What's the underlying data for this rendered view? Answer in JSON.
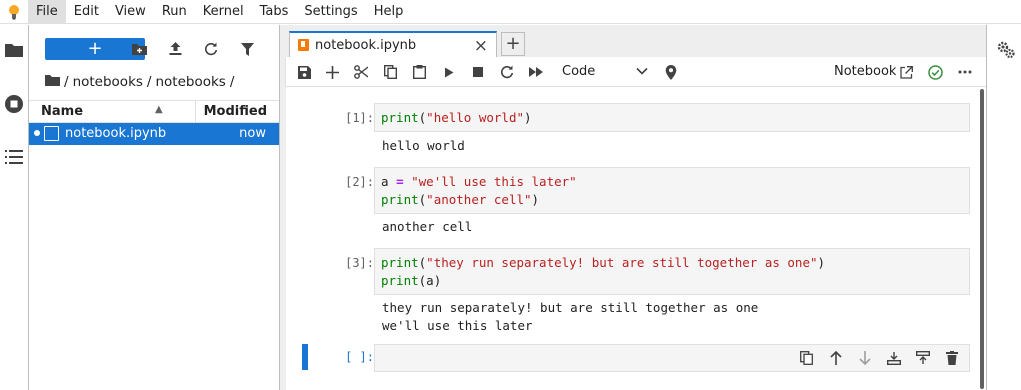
{
  "menubar": {
    "items": [
      "File",
      "Edit",
      "View",
      "Run",
      "Kernel",
      "Tabs",
      "Settings",
      "Help"
    ]
  },
  "filebrowser": {
    "new_label": "+",
    "breadcrumb": [
      "/",
      "notebooks",
      "/",
      "notebooks",
      "/"
    ],
    "col_name": "Name",
    "col_modified": "Modified",
    "files": [
      {
        "name": "notebook.ipynb",
        "modified": "now"
      }
    ]
  },
  "tabs": {
    "active_label": "notebook.ipynb",
    "close": "×",
    "add": "+"
  },
  "toolbar": {
    "cell_type": "Code",
    "kernel_label": "Notebook"
  },
  "cells": [
    {
      "prompt": "[1]:",
      "lines": [
        [
          {
            "t": "print",
            "c": "kw"
          },
          {
            "t": "(",
            "c": ""
          },
          {
            "t": "\"hello world\"",
            "c": "str"
          },
          {
            "t": ")",
            "c": ""
          }
        ]
      ],
      "output": [
        "hello world"
      ]
    },
    {
      "prompt": "[2]:",
      "lines": [
        [
          {
            "t": "a ",
            "c": ""
          },
          {
            "t": "=",
            "c": "op"
          },
          {
            "t": " ",
            "c": ""
          },
          {
            "t": "\"we'll use this later\"",
            "c": "str"
          }
        ],
        [
          {
            "t": "print",
            "c": "kw"
          },
          {
            "t": "(",
            "c": ""
          },
          {
            "t": "\"another cell\"",
            "c": "str"
          },
          {
            "t": ")",
            "c": ""
          }
        ]
      ],
      "output": [
        "another cell"
      ]
    },
    {
      "prompt": "[3]:",
      "lines": [
        [
          {
            "t": "print",
            "c": "kw"
          },
          {
            "t": "(",
            "c": ""
          },
          {
            "t": "\"they run separately! but are still together as one\"",
            "c": "str"
          },
          {
            "t": ")",
            "c": ""
          }
        ],
        [
          {
            "t": "print",
            "c": "kw"
          },
          {
            "t": "(a)",
            "c": ""
          }
        ]
      ],
      "output": [
        "they run separately! but are still together as one",
        "we'll use this later"
      ]
    }
  ],
  "empty_cell": {
    "prompt": "[ ]:"
  },
  "colors": {
    "accent": "#1976d2",
    "keyword": "#008000",
    "string": "#ba2121",
    "operator": "#aa22ff",
    "tab_icon": "#f57c00",
    "kernel_ok": "#388e3c"
  },
  "icons": {
    "logo": "jupyter-bulb-icon",
    "leftbar": [
      "folder-icon",
      "running-stop-icon",
      "toc-list-icon"
    ],
    "filebrowser_toolbar": [
      "new-folder-icon",
      "upload-icon",
      "refresh-icon",
      "filter-icon"
    ],
    "notebook_toolbar": [
      "save-icon",
      "insert-cell-icon",
      "cut-icon",
      "copy-icon",
      "paste-icon",
      "run-icon",
      "stop-icon",
      "restart-icon",
      "fast-forward-icon"
    ],
    "cell_actions": [
      "duplicate-icon",
      "move-up-icon",
      "move-down-icon",
      "insert-above-icon",
      "insert-below-icon",
      "delete-icon"
    ],
    "rightbar": [
      "property-inspector-gear-icon"
    ]
  }
}
